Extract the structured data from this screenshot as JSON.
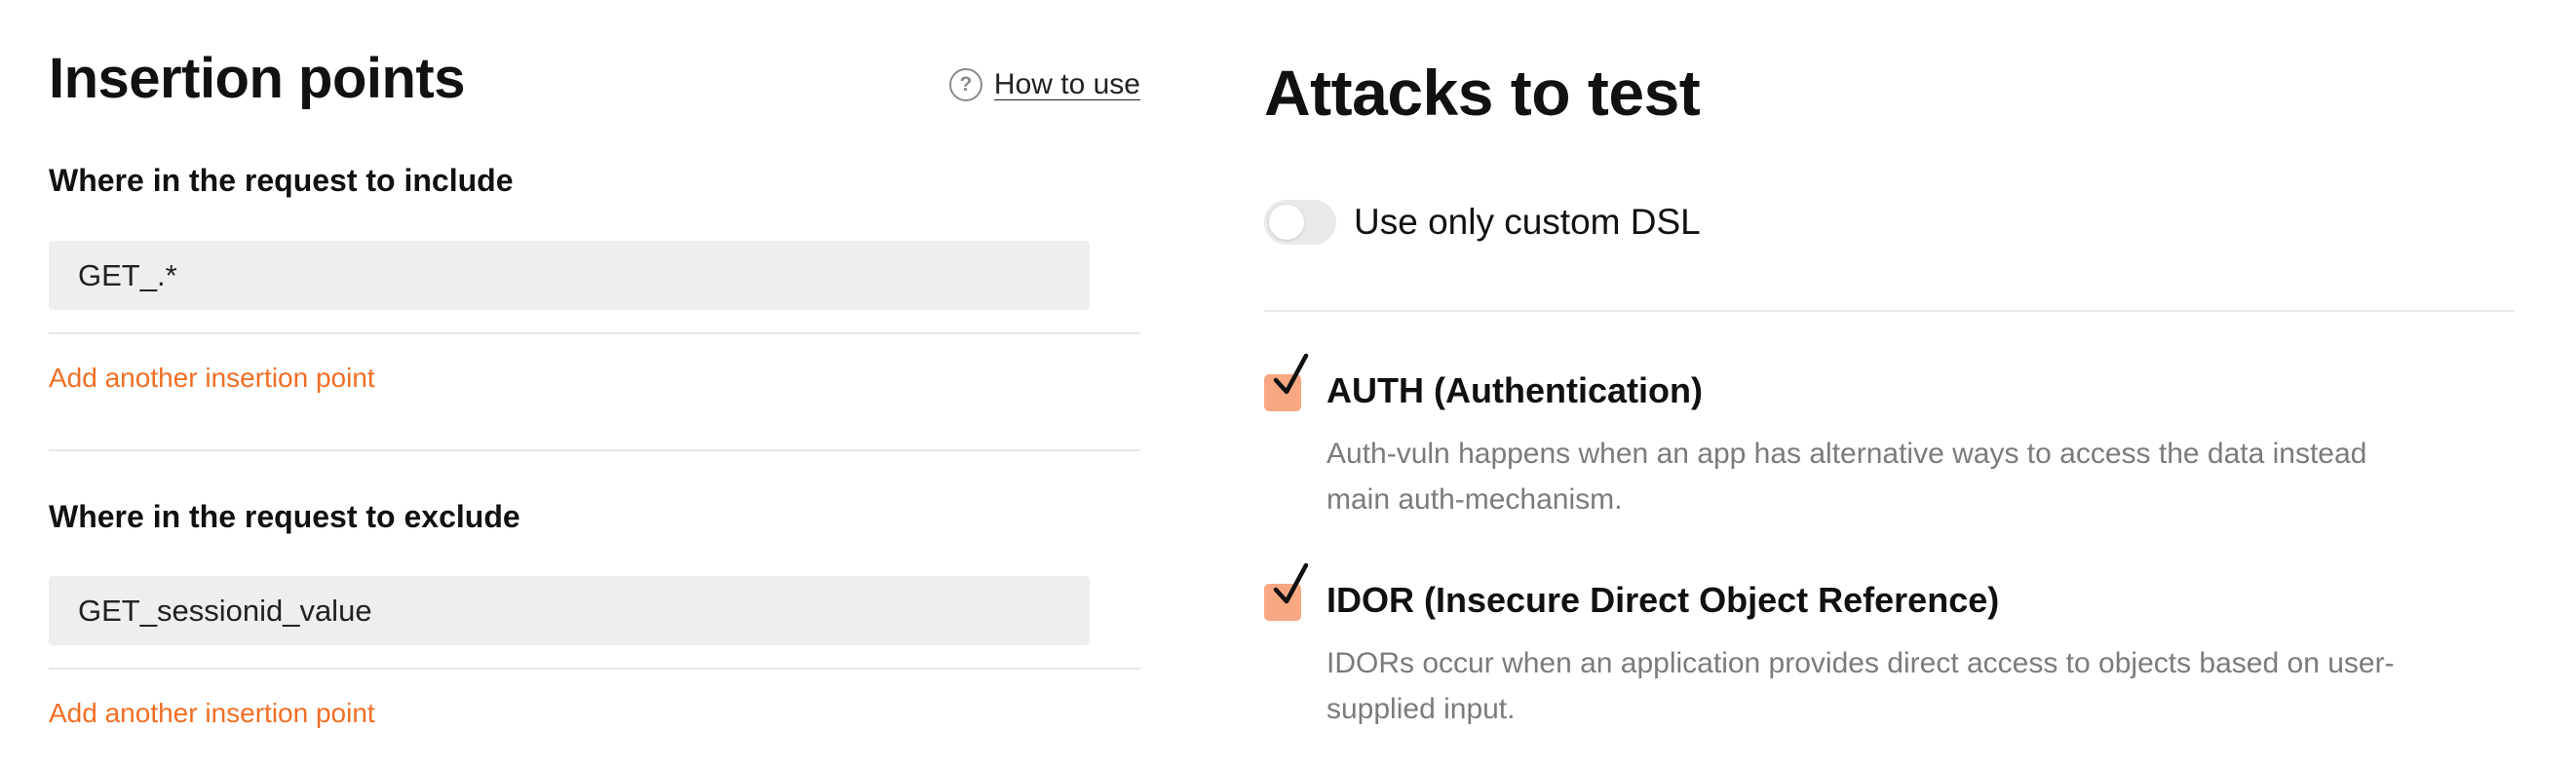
{
  "insertion_points": {
    "title": "Insertion points",
    "help_link": "How to use",
    "help_icon": "question-circle-icon",
    "include": {
      "label": "Where in the request to include",
      "value": "GET_.*",
      "add_link": "Add another insertion point"
    },
    "exclude": {
      "label": "Where in the request to exclude",
      "value": "GET_sessionid_value",
      "add_link": "Add another insertion point"
    }
  },
  "attacks": {
    "title": "Attacks to test",
    "custom_dsl_toggle": {
      "label": "Use only custom DSL",
      "enabled": false
    },
    "items": [
      {
        "title": "AUTH (Authentication)",
        "checked": true,
        "description": "Auth-vuln happens when an app has alternative ways to access the data instead main auth-mechanism."
      },
      {
        "title": "IDOR (Insecure Direct Object Reference)",
        "checked": true,
        "description": "IDORs occur when an application provides direct access to objects based on user-supplied input."
      }
    ]
  },
  "colors": {
    "accent": "#f06e24",
    "checkbox_fill": "#f7a782",
    "field_background": "#eeeeee",
    "muted_text": "#7b7b7b",
    "divider": "#e9e9e9"
  }
}
